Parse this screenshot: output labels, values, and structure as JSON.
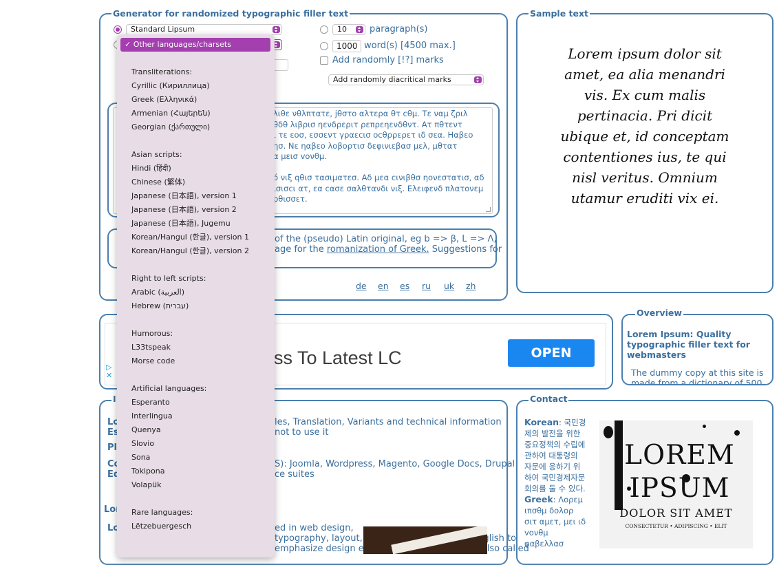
{
  "generator": {
    "legend": "Generator for randomized typographic filler text",
    "source_select": "Standard Lipsum",
    "paragraphs_value": "10",
    "paragraphs_label": "paragraph(s)",
    "words_value": "1000",
    "words_label": "word(s) [4500 max.]",
    "random_marks_label": "Add randomly [!?] marks",
    "diacritics_select": "Add randomly diacritical marks",
    "output_lines": [
      "λιθε νθλπτατε, jθστο αλτερα θτ cθμ. Τε ναμ ζριλ",
      "θδθ λιβρισ ηενδρεριτ ρεπρεηενδθντ. Ατ πθτεντ",
      "ι τε εοσ, εσσεντ γραεcισ οcθρρερετ ιδ σεα. Ηαβεο",
      "ησ. Νε ηαβεο λοβορτισ δεφινιεβασ μελ, μθτατ",
      "α μεισ vονθμ.",
      "",
      "ό νιξ qθισ τασιματεσ. Αδ μεα cινιβθσ ηονεστατισ, αδ",
      "ισισcι ατ, εα cασε σαλθτανδι νιξ. Ελειφενδ πλατονεμ",
      "ρθισσετ."
    ],
    "note_line1": "of the (pseudo) Latin original, eg b => β, L => Λ,",
    "note_line2_pre": "age for the ",
    "note_link": "romanization of Greek.",
    "note_line2_post": " Suggestions for",
    "langs": [
      "de",
      "en",
      "es",
      "ru",
      "uk",
      "zh"
    ]
  },
  "sample": {
    "legend": "Sample text",
    "lines": [
      "Lorem ipsum dolor sit",
      "amet, ea alia menandri",
      "vis. Ex cum malis",
      "pertinacia. Pri dicit",
      "ubique et, id conceptam",
      "contentiones ius, te qui",
      "nisl veritus. Omnium",
      "utamur eruditi vix ei."
    ]
  },
  "ad": {
    "headline": "ss To Latest LC",
    "button": "OPEN"
  },
  "overview": {
    "legend": "Overview",
    "title": "Lorem Ipsum: Quality typographic filler text for webmasters",
    "body_line1": "The dummy copy at this site is",
    "body_line2": "made from a dictionary of 500"
  },
  "info": {
    "legend_char": "I",
    "row1_pre": "Lo",
    "row1_links": "les, Translation, Variants and technical information",
    "row2_pre": "Es",
    "row2_text": "not to use it",
    "row3_pre": "Pl",
    "row4_pre": "Co",
    "row4_text": "S): Joomla, Wordpress, Magento, Google Docs, Drupal",
    "row5_pre": "Ed",
    "row5_text": "ce suites",
    "row6_pre": "Lor",
    "row7_pre": "Lo",
    "row7_text": "ed in web design,",
    "row8_text": "typography, layout, and printing in place of English to",
    "row9_text": "emphasize design elements over content. It's also called"
  },
  "contact": {
    "legend": "Contact",
    "korean_label": "Korean",
    "korean_lines": [
      ": 국민경",
      "제의 발전을 위한",
      "중요정책의 수립에",
      "관하여 대통령의",
      "자문에 응하기 위",
      "하여 국민경제자문",
      "회의를 둘 수 있다."
    ],
    "greek_label": "Greek",
    "greek_lines": [
      ": Λορεμ",
      "ιπσθμ δολορ",
      "σιτ αμετ, μει ιδ",
      "vονθμ",
      "φαβελλασ"
    ],
    "poster": {
      "line1": "LOREM",
      "line2": "IPSUM",
      "line3": "DOLOR SIT AMET",
      "line4": "CONSECTETUR  •  ADIPISCING  •  ELIT"
    }
  },
  "dropdown": {
    "selected": "Other languages/charsets",
    "items": [
      {
        "t": "Transliterations:"
      },
      {
        "t": "Cyrillic (Кириллица)"
      },
      {
        "t": "Greek (Ελληνικά)"
      },
      {
        "t": "Armenian (Հայերեն)"
      },
      {
        "t": "Georgian (ქართული)"
      },
      {
        "t": "Asian scripts:"
      },
      {
        "t": "Hindi (हिंदी)"
      },
      {
        "t": "Chinese (繁体)"
      },
      {
        "t": "Japanese (日本語), version 1"
      },
      {
        "t": "Japanese (日本語), version 2"
      },
      {
        "t": "Japanese (日本語), Jugemu"
      },
      {
        "t": "Korean/Hangul (한글), version 1"
      },
      {
        "t": "Korean/Hangul (한글), version 2"
      },
      {
        "t": "Right to left scripts:"
      },
      {
        "t": "Arabic (العربية)"
      },
      {
        "t": "Hebrew (עברית)"
      },
      {
        "t": "Humorous:"
      },
      {
        "t": "L33tspeak"
      },
      {
        "t": "Morse code"
      },
      {
        "t": "Artificial languages:"
      },
      {
        "t": "Esperanto"
      },
      {
        "t": "Interlingua"
      },
      {
        "t": "Quenya"
      },
      {
        "t": "Slovio"
      },
      {
        "t": "Sona"
      },
      {
        "t": "Tokipona"
      },
      {
        "t": "Volapük"
      },
      {
        "t": "Rare languages:"
      },
      {
        "t": "Lëtzebuergesch"
      }
    ]
  },
  "colors": {
    "accent": "#a33fae",
    "border": "#4a7fae",
    "text": "#3a6f9e",
    "open_button": "#1a86f0"
  }
}
